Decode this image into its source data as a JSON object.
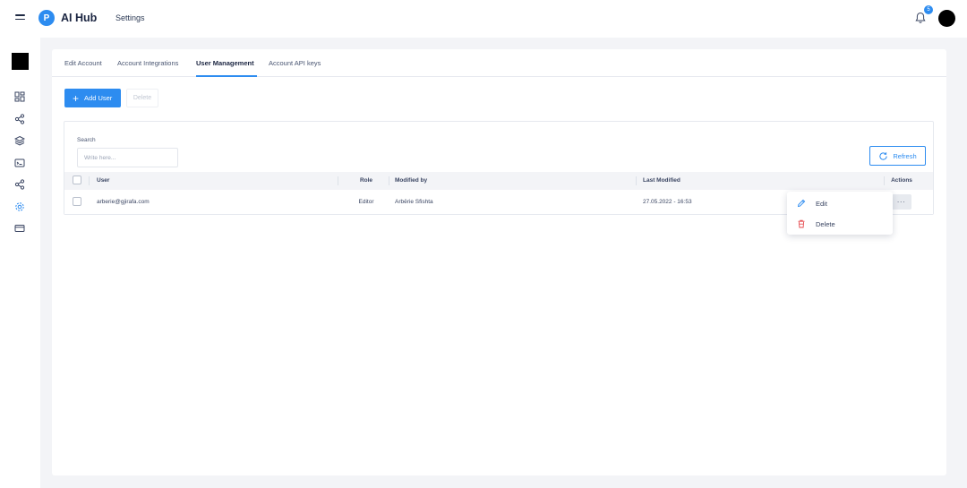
{
  "header": {
    "brand_logo_letter": "P",
    "brand_name": "AI Hub",
    "page_title": "Settings",
    "notification_count": "5"
  },
  "tabs": [
    {
      "label": "Edit Account",
      "active": false
    },
    {
      "label": "Account Integrations",
      "active": false
    },
    {
      "label": "User Management",
      "active": true
    },
    {
      "label": "Account API keys",
      "active": false
    }
  ],
  "toolbar": {
    "add_user_label": "Add User",
    "delete_label": "Delete"
  },
  "search": {
    "label": "Search",
    "placeholder": "Write here...",
    "value": ""
  },
  "refresh_label": "Refresh",
  "table": {
    "columns": [
      "User",
      "Role",
      "Modified by",
      "Last Modified",
      "Actions"
    ],
    "rows": [
      {
        "user": "arberie@gjirafa.com",
        "role": "Editor",
        "modified_by": "Arbërie Sfishta",
        "last_modified": "27.05.2022 - 16:53",
        "actions_label": "···"
      }
    ]
  },
  "actions_menu": {
    "edit_label": "Edit",
    "delete_label": "Delete"
  },
  "colors": {
    "accent": "#2d8cf0",
    "danger": "#e5484d",
    "text": "#1f2a44",
    "background": "#f3f4f7"
  },
  "sidebar_icons": [
    "dashboard-icon",
    "share-icon",
    "layers-icon",
    "terminal-icon",
    "share-icon",
    "settings-icon",
    "card-icon"
  ]
}
